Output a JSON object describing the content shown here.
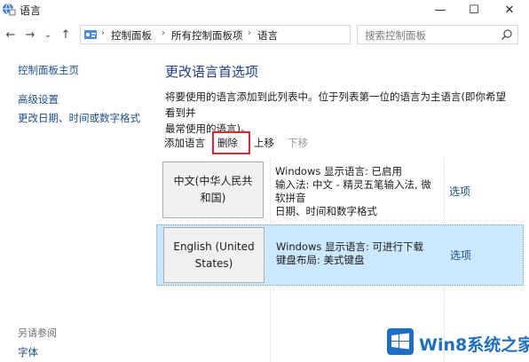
{
  "window": {
    "title": "语言",
    "controls": {
      "minimize": "—",
      "maximize": "☐",
      "close": "✕"
    }
  },
  "nav": {
    "back": "←",
    "forward": "→",
    "recent": "⌄",
    "up": "↑",
    "breadcrumb": [
      "控制面板",
      "所有控制面板项",
      "语言"
    ],
    "separator": "›",
    "dropdown": "⌄",
    "refresh": "↻",
    "search_placeholder": "搜索控制面板"
  },
  "sidebar": {
    "items": [
      {
        "label": "控制面板主页"
      },
      {
        "label": "高级设置"
      },
      {
        "label": "更改日期、时间或数字格式"
      }
    ],
    "see_also": "另请参阅",
    "see_also_items": [
      {
        "label": "字体"
      }
    ]
  },
  "main": {
    "title": "更改语言首选项",
    "description_line1": "将要使用的语言添加到此列表中。位于列表第一位的语言为主语言(即你希望看到并",
    "description_line2": "最常使用的语言)。",
    "toolbar": {
      "add": "添加语言",
      "delete": "删除",
      "move_up": "上移",
      "move_down": "下移"
    },
    "languages": [
      {
        "name_line1": "中文(中华人民共",
        "name_line2": "和国)",
        "info": [
          "Windows 显示语言: 已启用",
          "输入法: 中文 - 精灵五笔输入法, 微",
          "软拼音",
          "日期、时间和数字格式"
        ],
        "options": "选项",
        "selected": false
      },
      {
        "name_line1": "English (United",
        "name_line2": "States)",
        "info": [
          "Windows 显示语言: 可进行下载",
          "键盘布局: 美式键盘"
        ],
        "options": "选项",
        "selected": true
      }
    ]
  },
  "watermark": {
    "text": "Win8系统之家"
  },
  "colors": {
    "link": "#1a4f8b",
    "title": "#1e3f8e",
    "selected_row": "#cce8ff",
    "highlight_box": "#e0262c",
    "watermark": "#1c6fc4"
  }
}
